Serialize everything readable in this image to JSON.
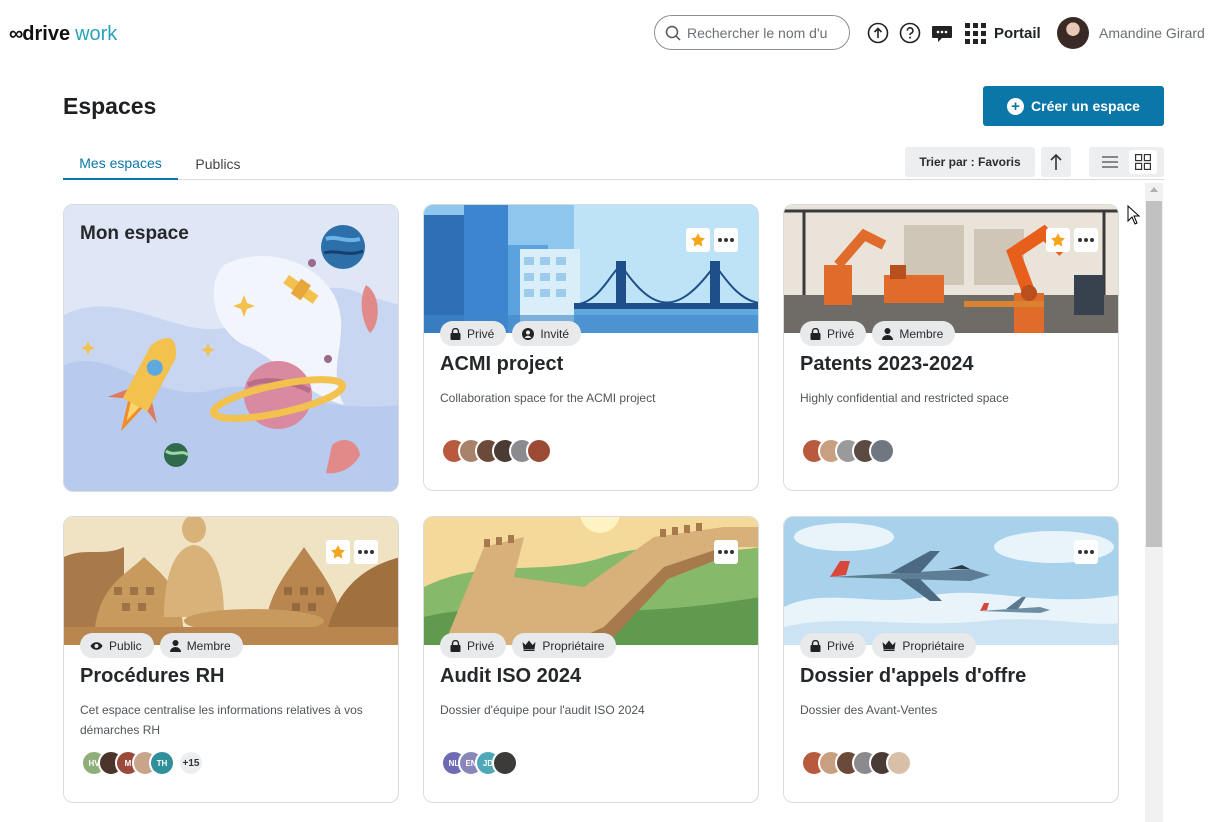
{
  "header": {
    "logo_mark": "∞",
    "logo_drive": "drive",
    "logo_work": "work",
    "search_placeholder": "Rechercher le nom d'u",
    "portal_label": "Portail",
    "user_name": "Amandine Girard"
  },
  "page": {
    "title": "Espaces",
    "create_label": "Créer un espace"
  },
  "tabs": [
    {
      "label": "Mes espaces",
      "active": true
    },
    {
      "label": "Publics",
      "active": false
    }
  ],
  "controls": {
    "sort_label": "Trier par : Favoris",
    "view_mode": "grid"
  },
  "colors": {
    "accent": "#0b76a8",
    "logo_work": "#2aa3b8",
    "favorite": "#f4a51c"
  },
  "my_space": {
    "title": "Mon espace"
  },
  "spaces": [
    {
      "title": "ACMI project",
      "description": "Collaboration space for the ACMI project",
      "favorite": true,
      "badges": [
        {
          "icon": "lock-icon",
          "label": "Privé"
        },
        {
          "icon": "guest-icon",
          "label": "Invité"
        }
      ],
      "members": [
        "",
        "",
        "",
        "",
        "",
        ""
      ],
      "more": ""
    },
    {
      "title": "Patents 2023-2024",
      "description": "Highly confidential and restricted space",
      "favorite": true,
      "badges": [
        {
          "icon": "lock-icon",
          "label": "Privé"
        },
        {
          "icon": "person-icon",
          "label": "Membre"
        }
      ],
      "members": [
        "",
        "",
        "",
        "",
        ""
      ],
      "more": ""
    },
    {
      "title": "Procédures RH",
      "description": "Cet espace centralise les informations relatives à vos démarches RH",
      "favorite": true,
      "badges": [
        {
          "icon": "eye-icon",
          "label": "Public"
        },
        {
          "icon": "person-icon",
          "label": "Membre"
        }
      ],
      "members": [
        "HV",
        "",
        "M",
        "",
        "TH"
      ],
      "more": "+15"
    },
    {
      "title": "Audit ISO 2024",
      "description": "Dossier d'équipe pour l'audit ISO 2024",
      "favorite": false,
      "badges": [
        {
          "icon": "lock-icon",
          "label": "Privé"
        },
        {
          "icon": "crown-icon",
          "label": "Propriétaire"
        }
      ],
      "members": [
        "NL",
        "EN",
        "JD",
        ""
      ],
      "more": ""
    },
    {
      "title": "Dossier d'appels d'offre",
      "description": "Dossier des Avant-Ventes",
      "favorite": false,
      "badges": [
        {
          "icon": "lock-icon",
          "label": "Privé"
        },
        {
          "icon": "crown-icon",
          "label": "Propriétaire"
        }
      ],
      "members": [
        "",
        "",
        "",
        "",
        "",
        ""
      ],
      "more": ""
    }
  ]
}
